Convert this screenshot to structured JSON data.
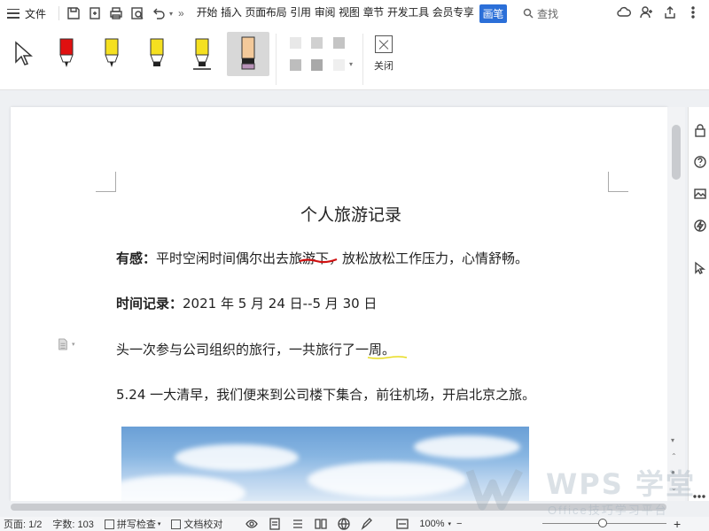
{
  "menubar": {
    "file_label": "文件",
    "tabs": [
      "开始",
      "插入",
      "页面布局",
      "引用",
      "审阅",
      "视图",
      "章节",
      "开发工具",
      "会员专享"
    ],
    "active_tab": "画笔",
    "search_label": "查找",
    "more_label": "»"
  },
  "toolbar": {
    "close_label": "关闭",
    "pens": [
      {
        "name": "select-arrow",
        "color": "#ffffff"
      },
      {
        "name": "red-pen",
        "color": "#e01010"
      },
      {
        "name": "yellow-pen",
        "color": "#f5e020"
      },
      {
        "name": "yellow-highlighter",
        "color": "#f5e020"
      },
      {
        "name": "yellow-highlighter-wide",
        "color": "#f5e020"
      },
      {
        "name": "eraser",
        "color": "#f3c99a"
      }
    ],
    "swatches": [
      "#e8e8e8",
      "#d0d0d0",
      "#c4c4c4",
      "#bdbdbd",
      "#a9a9a9",
      "#efefef"
    ]
  },
  "document": {
    "title": "个人旅游记录",
    "p1_label": "有感：",
    "p1_text": "平时空闲时间偶尔出去旅游下，放松放松工作压力，心情舒畅。",
    "p2_label": "时间记录：",
    "p2_text": "2021 年 5 月 24 日--5 月 30 日",
    "p3_text": "头一次参与公司组织的旅行，一共旅行了一周。",
    "p4_text": "5.24 一大清早，我们便来到公司楼下集合，前往机场，开启北京之旅。"
  },
  "statusbar": {
    "page": "页面: 1/2",
    "word_count": "字数: 103",
    "spell_check": "拼写检查",
    "doc_check": "文档校对",
    "zoom": "100%",
    "zoom_minus": "−",
    "zoom_plus": "+"
  },
  "watermark": {
    "title": "WPS 学堂",
    "subtitle": "Office技巧学习平台"
  }
}
